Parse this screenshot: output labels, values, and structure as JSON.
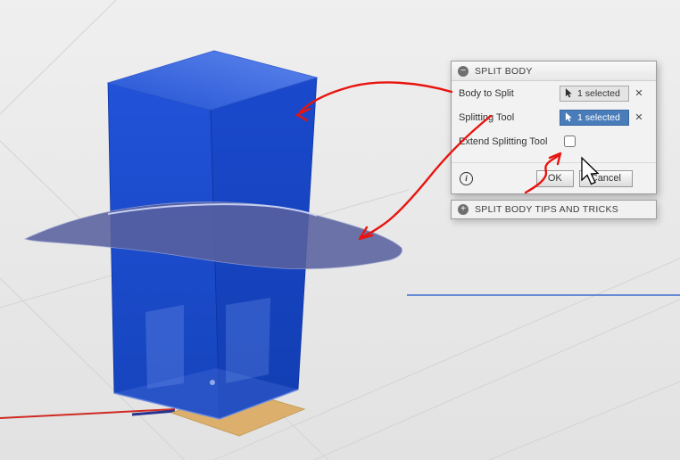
{
  "dialog": {
    "title": "SPLIT BODY",
    "body_to_split_label": "Body to Split",
    "body_to_split_value": "1 selected",
    "splitting_tool_label": "Splitting Tool",
    "splitting_tool_value": "1 selected",
    "extend_label": "Extend Splitting Tool",
    "extend_checked": false,
    "ok_label": "OK",
    "cancel_label": "Cancel"
  },
  "tips": {
    "title": "SPLIT BODY TIPS AND TRICKS"
  },
  "icons": {
    "collapse": "−",
    "expand": "+",
    "clear": "✕",
    "info": "i"
  },
  "colors": {
    "body_blue": "#1c4ed2",
    "split_surface_purple": "#59619f",
    "selected_button_blue": "#4a7cba",
    "annotation_red": "#e8140e",
    "origin_plane_tan": "#dcab60",
    "axis_blue": "#3e6fd1",
    "axis_red": "#cf2a21",
    "viewport_gray": "#e9e9e9"
  },
  "scene": {
    "objects": [
      "box-body",
      "wavy-split-surface",
      "origin-plane",
      "ground-grid",
      "axes"
    ]
  }
}
